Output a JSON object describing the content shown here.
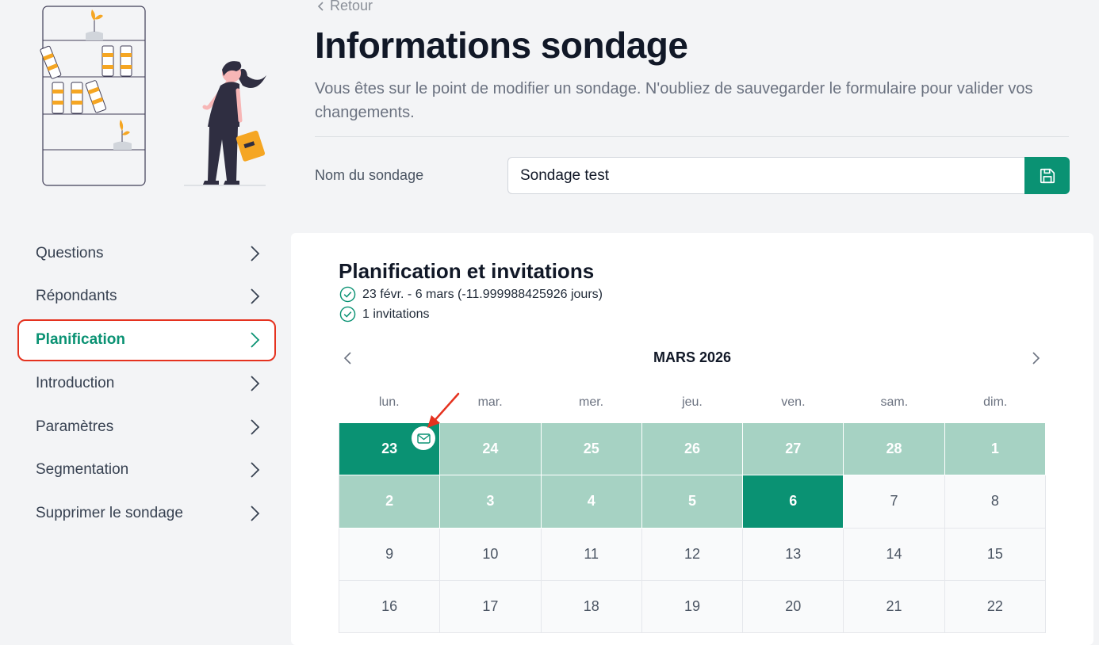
{
  "header": {
    "back_label": "Retour",
    "title": "Informations sondage",
    "description": "Vous êtes sur le point de modifier un sondage. N'oubliez de sauvegarder le formulaire pour valider vos changements.",
    "name_label": "Nom du sondage",
    "name_value": "Sondage test",
    "save_icon": "save-icon"
  },
  "sidebar": {
    "items": [
      {
        "label": "Questions"
      },
      {
        "label": "Répondants"
      },
      {
        "label": "Planification",
        "active": true
      },
      {
        "label": "Introduction"
      },
      {
        "label": "Paramètres"
      },
      {
        "label": "Segmentation"
      },
      {
        "label": "Supprimer le sondage"
      }
    ]
  },
  "planning": {
    "title": "Planification et invitations",
    "period_summary": "23 févr. - 6 mars (-11.999988425926 jours)",
    "invitations_summary": "1 invitations"
  },
  "calendar": {
    "month_label": "MARS 2026",
    "weekdays": [
      "lun.",
      "mar.",
      "mer.",
      "jeu.",
      "ven.",
      "sam.",
      "dim."
    ],
    "Row_1": [
      "23",
      "24",
      "25",
      "26",
      "27",
      "28",
      "1"
    ],
    "Row_2": [
      "2",
      "3",
      "4",
      "5",
      "6",
      "7",
      "8"
    ],
    "Row_3": [
      "9",
      "10",
      "11",
      "12",
      "13",
      "14",
      "15"
    ],
    "Row_4": [
      "16",
      "17",
      "18",
      "19",
      "20",
      "21",
      "22"
    ],
    "range_start": "23",
    "range_end": "6",
    "invitation_day": "23"
  },
  "colors": {
    "accent": "#0a9273",
    "range_fill": "#a6d2c3",
    "highlight_outline": "#e5321f",
    "annotation_arrow": "#e5321f"
  }
}
